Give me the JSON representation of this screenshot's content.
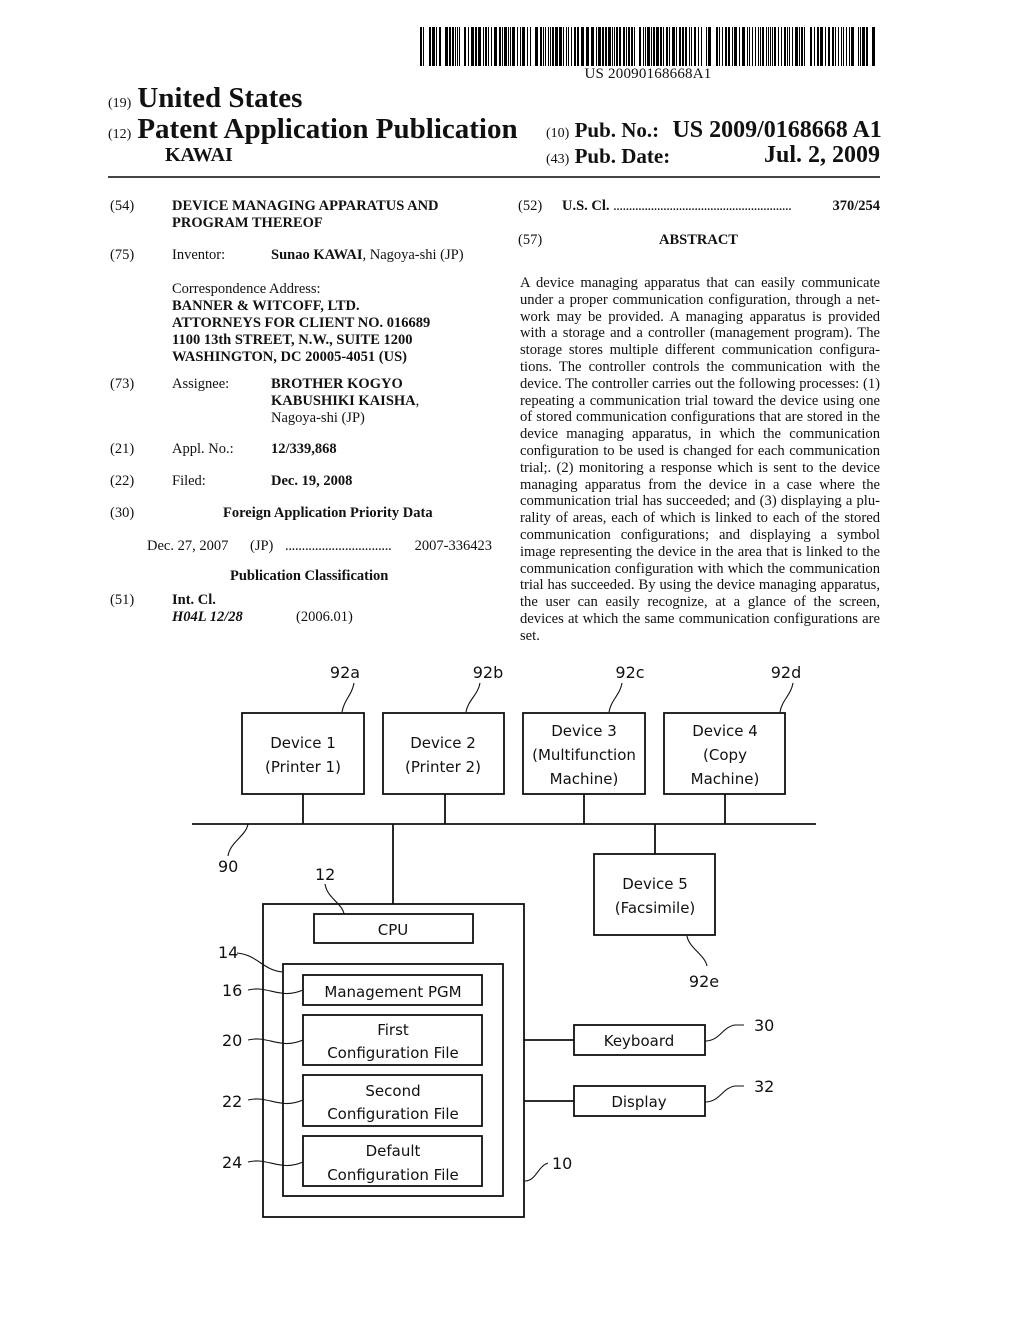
{
  "header": {
    "barcode_text": "US 20090168668A1",
    "country_code": "(19)",
    "country": "United States",
    "pub_type_code": "(12)",
    "pub_type": "Patent Application Publication",
    "inventor_surname": "KAWAI",
    "pub_no_code": "(10)",
    "pub_no_label": "Pub. No.:",
    "pub_no": "US 2009/0168668 A1",
    "pub_date_code": "(43)",
    "pub_date_label": "Pub. Date:",
    "pub_date": "Jul. 2, 2009"
  },
  "biblio": {
    "title_code": "(54)",
    "title_line1": "DEVICE MANAGING APPARATUS AND",
    "title_line2": "PROGRAM THEREOF",
    "inventor_code": "(75)",
    "inventor_label": "Inventor:",
    "inventor_name": "Sunao KAWAI",
    "inventor_location": ", Nagoya-shi (JP)",
    "correspondence_label": "Correspondence Address:",
    "correspondence_lines": [
      "BANNER & WITCOFF, LTD.",
      "ATTORNEYS FOR CLIENT NO. 016689",
      "1100 13th STREET, N.W., SUITE 1200",
      "WASHINGTON, DC 20005-4051 (US)"
    ],
    "assignee_code": "(73)",
    "assignee_label": "Assignee:",
    "assignee_line1": "BROTHER KOGYO",
    "assignee_line2": "KABUSHIKI KAISHA",
    "assignee_location": "Nagoya-shi (JP)",
    "appl_code": "(21)",
    "appl_label": "Appl. No.:",
    "appl_no": "12/339,868",
    "filed_code": "(22)",
    "filed_label": "Filed:",
    "filed_date": "Dec. 19, 2008",
    "foreign_code": "(30)",
    "foreign_heading": "Foreign Application Priority Data",
    "foreign_date": "Dec. 27, 2007",
    "foreign_country": "(JP)",
    "foreign_dots": "................................",
    "foreign_number": "2007-336423",
    "pub_class_heading": "Publication Classification",
    "intcl_code": "(51)",
    "intcl_label": "Int. Cl.",
    "intcl_class": "H04L 12/28",
    "intcl_version": "(2006.01)",
    "uscl_code": "(52)",
    "uscl_label": "U.S. Cl.",
    "uscl_dots": ".........................................................",
    "uscl_value": "370/254",
    "abstract_code": "(57)",
    "abstract_heading": "ABSTRACT"
  },
  "abstract": "A device managing apparatus that can easily communicate under a proper communication configuration, through a net-work may be provided. A managing apparatus is provided with a storage and a controller (management program). The storage stores multiple different communication configura-tions. The controller controls the communication with the device. The controller carries out the following processes: (1) repeating a communication trial toward the device using one of stored communication configurations that are stored in the device managing apparatus, in which the communication configuration to be used is changed for each communication trial;. (2) monitoring a response which is sent to the device managing apparatus from the device in a case where the communication trial has succeeded; and (3) displaying a plu-rality of areas, each of which is linked to each of the stored communication configurations; and displaying a symbol image representing the device in the area that is linked to the communication configuration with which the communication trial has succeeded. By using the device managing apparatus, the user can easily recognize, at a glance of the screen, devices at which the same communication configurations are set.",
  "diagram": {
    "devices": [
      {
        "ref": "92a",
        "lines": [
          "Device 1",
          "(Printer 1)"
        ]
      },
      {
        "ref": "92b",
        "lines": [
          "Device 2",
          "(Printer 2)"
        ]
      },
      {
        "ref": "92c",
        "lines": [
          "Device 3",
          "(Multifunction",
          "Machine)"
        ]
      },
      {
        "ref": "92d",
        "lines": [
          "Device 4",
          "(Copy",
          "Machine)"
        ]
      },
      {
        "ref": "92e",
        "lines": [
          "Device 5",
          "(Facsimile)"
        ]
      }
    ],
    "network_ref": "90",
    "computer_ref": "10",
    "cpu_ref": "12",
    "cpu_label": "CPU",
    "storage_ref": "14",
    "files": [
      {
        "ref": "16",
        "lines": [
          "Management PGM"
        ]
      },
      {
        "ref": "20",
        "lines": [
          "First",
          "Configuration File"
        ]
      },
      {
        "ref": "22",
        "lines": [
          "Second",
          "Configuration File"
        ]
      },
      {
        "ref": "24",
        "lines": [
          "Default",
          "Configuration File"
        ]
      }
    ],
    "peripherals": [
      {
        "ref": "30",
        "label": "Keyboard"
      },
      {
        "ref": "32",
        "label": "Display"
      }
    ]
  }
}
